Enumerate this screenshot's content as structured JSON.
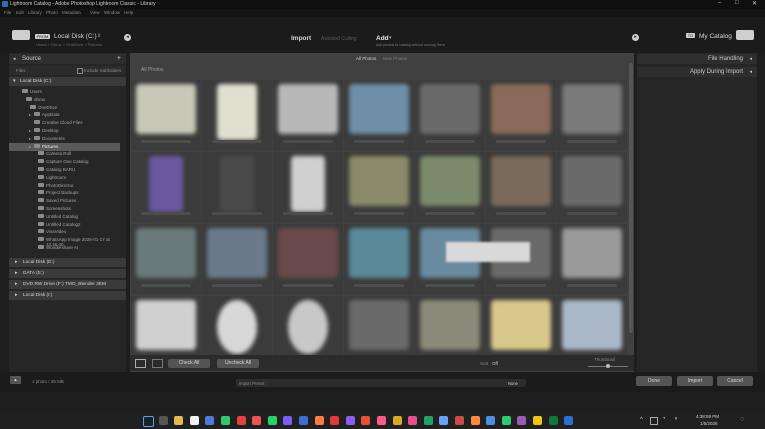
{
  "window": {
    "title": "Lightroom Catalog - Adobe Photoshop Lightroom Classic - Library",
    "controls": [
      "–",
      "□",
      "✕"
    ]
  },
  "menu": [
    "File",
    "Edit",
    "Library",
    "Photo",
    "Metadata",
    "View",
    "Window",
    "Help"
  ],
  "header": {
    "from_badge": "FROM",
    "source_name": "Local Disk (C:)",
    "source_sub": "Users > Dhruv > OneDrive > Pictures",
    "modes": [
      "Import",
      "Assisted Culling",
      "Add"
    ],
    "add_sub": "Add photos to catalog without moving them",
    "to_badge": "TO",
    "to_name": "My Catalog"
  },
  "source_panel": {
    "title": "Source",
    "include_subfolders": "Include Subfolders",
    "files_label": "Files",
    "drive_c": "Local Disk (C:)",
    "tree": [
      {
        "label": "Users",
        "indent": 1,
        "folder": false
      },
      {
        "label": "dhruv",
        "indent": 2,
        "folder": false
      },
      {
        "label": "OneDrive",
        "indent": 3,
        "folder": false
      },
      {
        "label": "AppData",
        "indent": 4,
        "folder": true
      },
      {
        "label": "Creative Cloud Files",
        "indent": 4,
        "folder": false
      },
      {
        "label": "Desktop",
        "indent": 4,
        "folder": true
      },
      {
        "label": "Documents",
        "indent": 4,
        "folder": true
      },
      {
        "label": "Pictures",
        "indent": 4,
        "folder": true,
        "selected": true
      },
      {
        "label": "Camera Roll",
        "indent": 5,
        "folder": false
      },
      {
        "label": "Capture One Catalog",
        "indent": 5,
        "folder": false
      },
      {
        "label": "Catalog BARU",
        "indent": 5,
        "folder": false
      },
      {
        "label": "Lightroom",
        "indent": 5,
        "folder": false
      },
      {
        "label": "PhotoDirector",
        "indent": 5,
        "folder": false
      },
      {
        "label": "Project Backups",
        "indent": 5,
        "folder": false
      },
      {
        "label": "Saved Pictures",
        "indent": 5,
        "folder": false
      },
      {
        "label": "Screenshots",
        "indent": 5,
        "folder": false
      },
      {
        "label": "Untitled Catalog",
        "indent": 5,
        "folder": false
      },
      {
        "label": "Untitled Catalog2",
        "indent": 5,
        "folder": false
      },
      {
        "label": "VivaVideo",
        "indent": 5,
        "folder": false
      },
      {
        "label": "WhatsApp Image 2026-01-17 at 12.46.40",
        "indent": 5,
        "folder": false
      },
      {
        "label": "Wondershare AI",
        "indent": 5,
        "folder": false
      }
    ],
    "drives": [
      "Local Disk (D:)",
      "DATA (E:)",
      "DVD RW Drive (F:) TMO_Blender 3EM",
      "Local Disk (I:)"
    ]
  },
  "grid": {
    "header_left": "All Photos",
    "tabs": [
      "All Photos",
      "New Photos"
    ],
    "sort_label": "Sort",
    "sort_value": "Off",
    "thumbnail_label": "Thumbnail",
    "check_all": "Check All",
    "uncheck_all": "Uncheck All"
  },
  "right_panel": {
    "file_handling": "File Handling",
    "apply_during_import": "Apply During Import"
  },
  "footer": {
    "count": "1 photo / 39 MB",
    "preset_label": "Import Preset :",
    "preset_value": "None",
    "done": "Done",
    "import": "Import",
    "cancel": "Cancel"
  },
  "taskbar": {
    "time": "4:38:59 PM",
    "date": "1/5/2026",
    "icons": [
      "windows-icon",
      "search-icon",
      "explorer-icon",
      "k-icon",
      "app-icon",
      "whatsapp-icon",
      "app-icon",
      "photoshop-icon",
      "app-icon",
      "app-icon",
      "app-icon",
      "chrome-icon",
      "app-icon",
      "app-icon",
      "app-icon",
      "lightroom-icon"
    ]
  },
  "thumb_colors": [
    [
      "#c8c8b8",
      "#e0e0d0",
      "#b8b8b8",
      "#6f8fa8",
      "#6a6a6a",
      "#8a6a5a",
      "#7a7a7a"
    ],
    [
      "#6a58a0",
      "#4a4a4a",
      "#d0d0d0",
      "#8a8a6a",
      "#7a8a6a",
      "#7a6a5a",
      "#6a6a6a"
    ],
    [
      "#6a7a7a",
      "#6a7a8a",
      "#6a4a4a",
      "#5a8a9a",
      "#6a8aa0",
      "#6a6a6a",
      "#9a9a9a"
    ],
    [
      "#d0d0d0",
      "#d8d8d8",
      "#c8c8c8",
      "#6a6a6a",
      "#8a8a7a",
      "#d8c88a",
      "#aab8c8"
    ]
  ]
}
